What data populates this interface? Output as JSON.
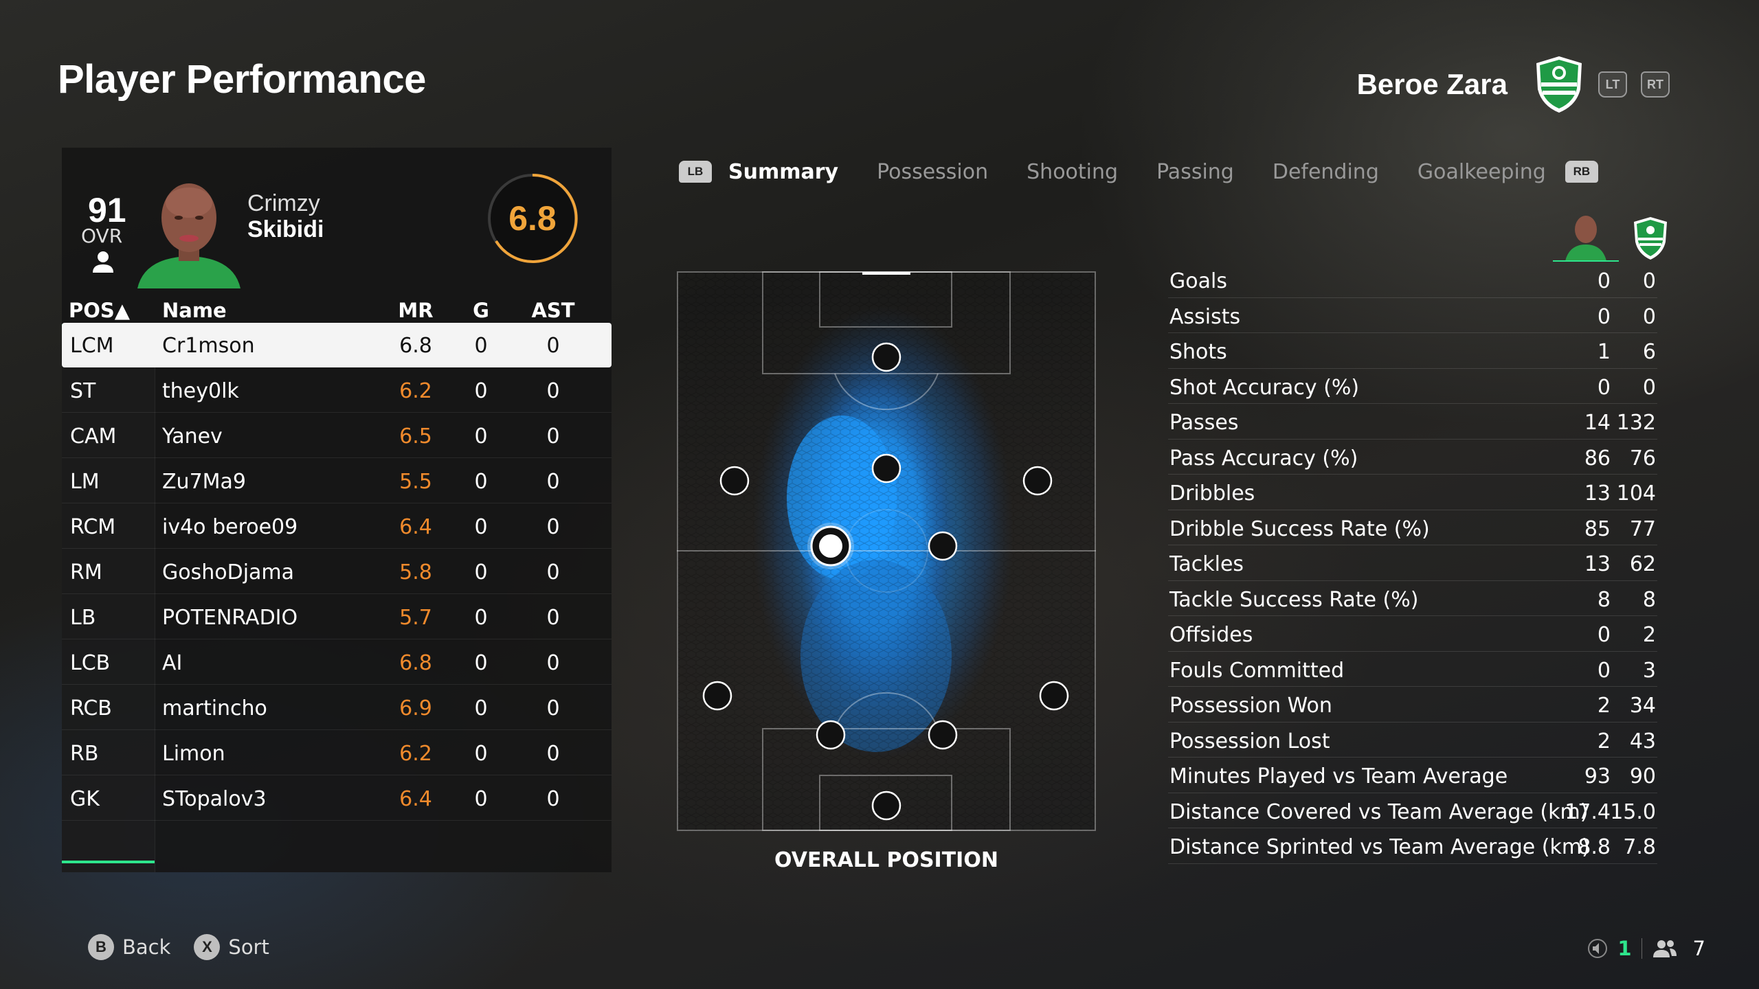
{
  "page_title": "Player Performance",
  "team": {
    "name": "Beroe Zara",
    "lt": "LT",
    "rt": "RT",
    "crest_color": "#1f9a45"
  },
  "player": {
    "ovr": "91",
    "ovr_label": "OVR",
    "first_name": "Crimzy",
    "last_name": "Skibidi",
    "rating": "6.8"
  },
  "table": {
    "headers": {
      "pos": "POS▲",
      "name": "Name",
      "mr": "MR",
      "g": "G",
      "ast": "AST"
    },
    "rows": [
      {
        "pos": "LCM",
        "name": "Cr1mson",
        "mr": "6.8",
        "g": "0",
        "ast": "0"
      },
      {
        "pos": "ST",
        "name": "they0lk",
        "mr": "6.2",
        "g": "0",
        "ast": "0"
      },
      {
        "pos": "CAM",
        "name": "Yanev",
        "mr": "6.5",
        "g": "0",
        "ast": "0"
      },
      {
        "pos": "LM",
        "name": "Zu7Ma9",
        "mr": "5.5",
        "g": "0",
        "ast": "0"
      },
      {
        "pos": "RCM",
        "name": "iv4o beroe09",
        "mr": "6.4",
        "g": "0",
        "ast": "0"
      },
      {
        "pos": "RM",
        "name": "GoshoDjama",
        "mr": "5.8",
        "g": "0",
        "ast": "0"
      },
      {
        "pos": "LB",
        "name": "POTENRADIO",
        "mr": "5.7",
        "g": "0",
        "ast": "0"
      },
      {
        "pos": "LCB",
        "name": "AI",
        "mr": "6.8",
        "g": "0",
        "ast": "0"
      },
      {
        "pos": "RCB",
        "name": "martincho",
        "mr": "6.9",
        "g": "0",
        "ast": "0"
      },
      {
        "pos": "RB",
        "name": "Limon",
        "mr": "6.2",
        "g": "0",
        "ast": "0"
      },
      {
        "pos": "GK",
        "name": "STopalov3",
        "mr": "6.4",
        "g": "0",
        "ast": "0"
      }
    ]
  },
  "tabs": {
    "lb": "LB",
    "rb": "RB",
    "items": [
      "Summary",
      "Possession",
      "Shooting",
      "Passing",
      "Defending",
      "Goalkeeping"
    ],
    "active": "Summary"
  },
  "pitch": {
    "label": "OVERALL POSITION",
    "heat_color": "#1e9bff"
  },
  "stats": [
    {
      "label": "Goals",
      "player": "0",
      "team": "0"
    },
    {
      "label": "Assists",
      "player": "0",
      "team": "0"
    },
    {
      "label": "Shots",
      "player": "1",
      "team": "6"
    },
    {
      "label": "Shot Accuracy (%)",
      "player": "0",
      "team": "0"
    },
    {
      "label": "Passes",
      "player": "14",
      "team": "132"
    },
    {
      "label": "Pass Accuracy (%)",
      "player": "86",
      "team": "76"
    },
    {
      "label": "Dribbles",
      "player": "13",
      "team": "104"
    },
    {
      "label": "Dribble Success Rate (%)",
      "player": "85",
      "team": "77"
    },
    {
      "label": "Tackles",
      "player": "13",
      "team": "62"
    },
    {
      "label": "Tackle Success Rate (%)",
      "player": "8",
      "team": "8"
    },
    {
      "label": "Offsides",
      "player": "0",
      "team": "2"
    },
    {
      "label": "Fouls Committed",
      "player": "0",
      "team": "3"
    },
    {
      "label": "Possession Won",
      "player": "2",
      "team": "34"
    },
    {
      "label": "Possession Lost",
      "player": "2",
      "team": "43"
    },
    {
      "label": "Minutes Played vs Team Average",
      "player": "93",
      "team": "90"
    },
    {
      "label": "Distance Covered vs Team Average (km)",
      "player": "17.4",
      "team": "15.0"
    },
    {
      "label": "Distance Sprinted vs Team Average (km)",
      "player": "8.8",
      "team": "7.8"
    }
  ],
  "footer": {
    "back": {
      "key": "B",
      "label": "Back"
    },
    "sort": {
      "key": "X",
      "label": "Sort"
    },
    "count_a": "1",
    "count_b": "7"
  },
  "colors": {
    "accent": "#2ee58c",
    "rating": "#f0a43a",
    "mr": "#f08a2c"
  }
}
